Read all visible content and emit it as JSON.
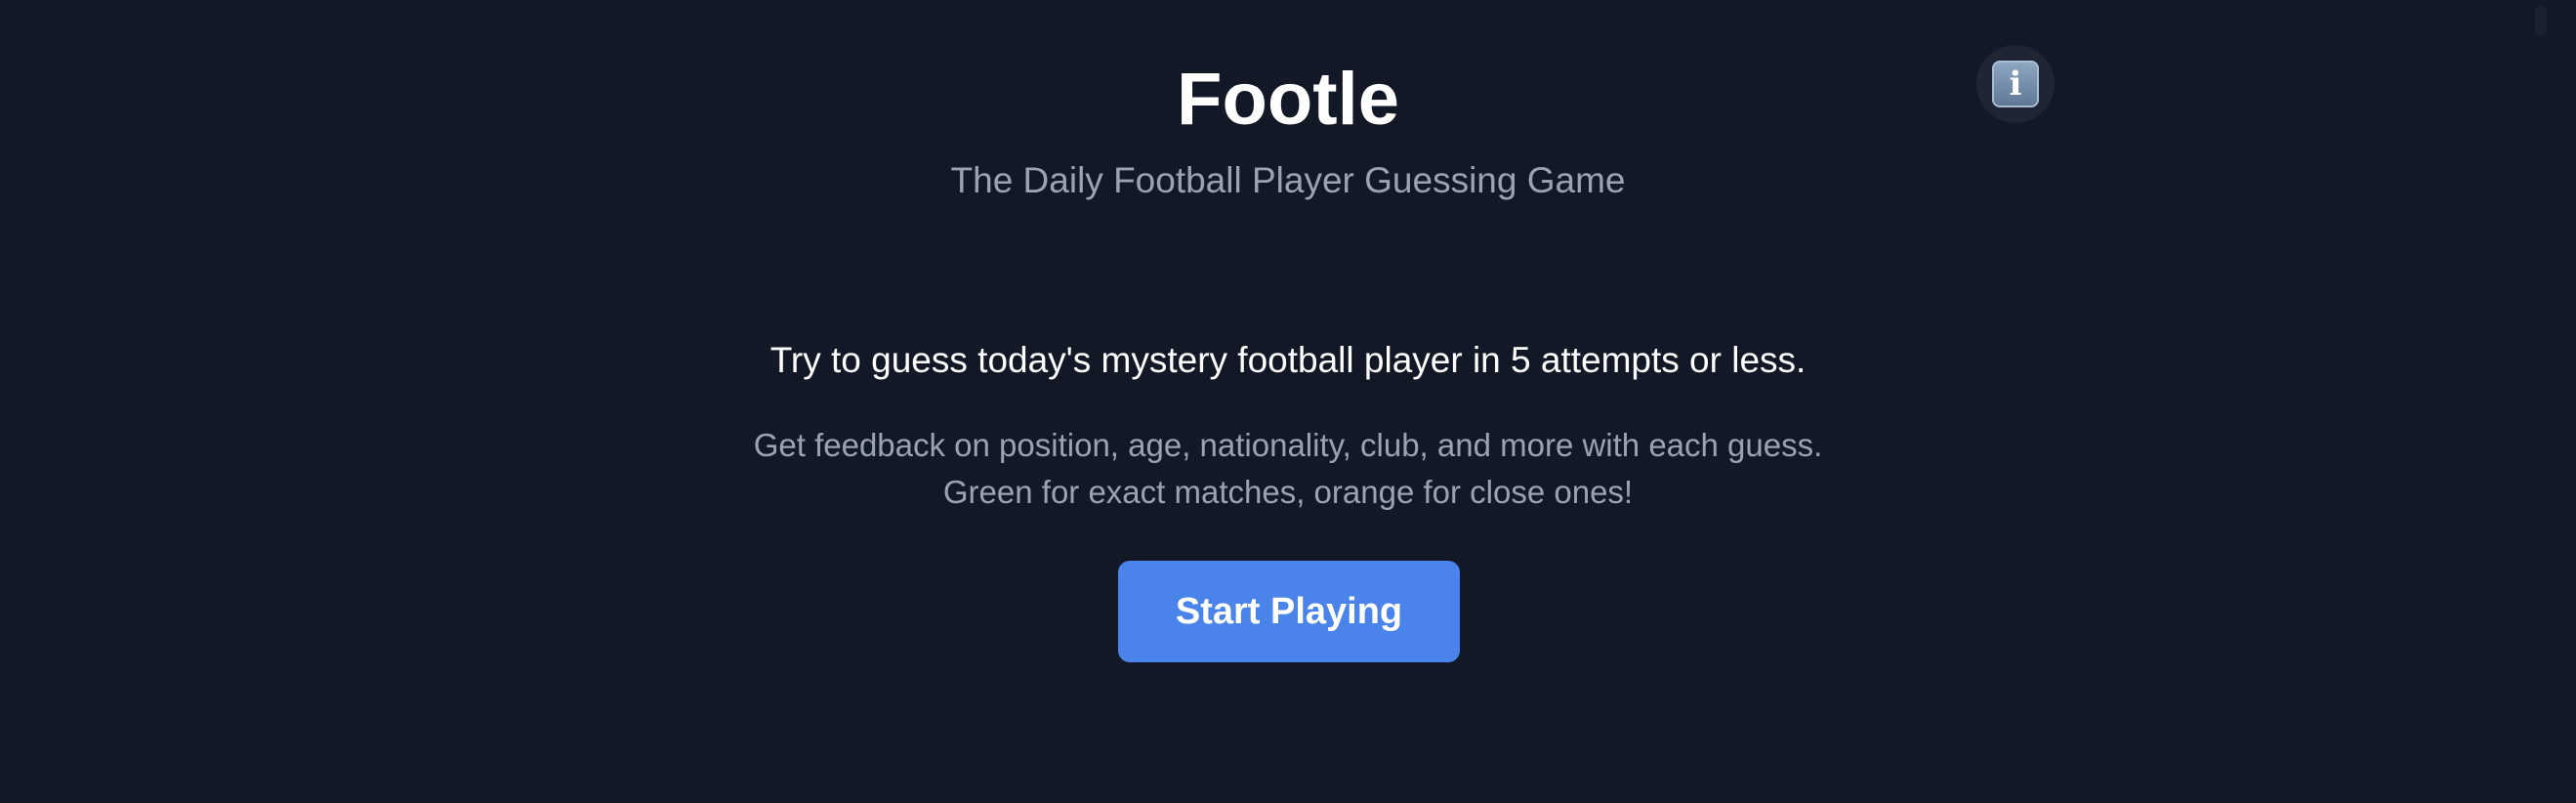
{
  "header": {
    "title": "Footle",
    "subtitle": "The Daily Football Player Guessing Game",
    "info_icon": "info-icon"
  },
  "intro": {
    "headline": "Try to guess today's mystery football player in 5 attempts or less.",
    "description_line1": "Get feedback on position, age, nationality, club, and more with each guess.",
    "description_line2": "Green for exact matches, orange for close ones!"
  },
  "actions": {
    "start_label": "Start Playing"
  },
  "colors": {
    "background": "#131826",
    "accent": "#4a83ea",
    "muted_text": "#9aa3b2"
  }
}
